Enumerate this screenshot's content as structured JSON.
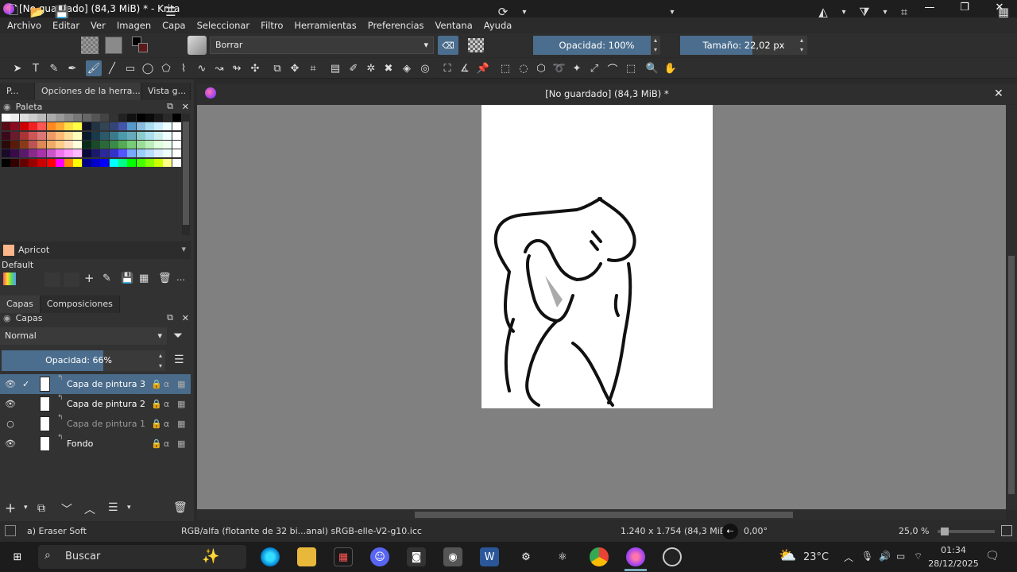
{
  "window": {
    "title": "[No guardado]  (84,3 MiB) * - Krita"
  },
  "menu": [
    "Archivo",
    "Editar",
    "Ver",
    "Imagen",
    "Capa",
    "Seleccionar",
    "Filtro",
    "Herramientas",
    "Preferencias",
    "Ventana",
    "Ayuda"
  ],
  "toolbar": {
    "blend_mode": "Borrar",
    "opacity_label": "Opacidad: 100%",
    "size_label": "Tamaño: 22,02 px"
  },
  "left_tabs": [
    "P...",
    "Opciones de la herra...",
    "Vista g..."
  ],
  "palette": {
    "title": "Paleta",
    "selected_color_name": "Apricot",
    "palette_name": "Default"
  },
  "layers_tabs": [
    "Capas",
    "Composiciones"
  ],
  "layers": {
    "title": "Capas",
    "blend_mode": "Normal",
    "opacity_label": "Opacidad:  66%",
    "opacity": 0.66,
    "items": [
      {
        "name": "Capa de pintura 3",
        "visible": true,
        "selected": true
      },
      {
        "name": "Capa de pintura 2",
        "visible": true,
        "selected": false
      },
      {
        "name": "Capa de pintura 1",
        "visible": false,
        "selected": false
      },
      {
        "name": "Fondo",
        "visible": true,
        "selected": false
      }
    ]
  },
  "document": {
    "title": "[No guardado]  (84,3 MiB) *"
  },
  "status": {
    "brush": "a) Eraser Soft",
    "color_space": "RGB/alfa (flotante de 32 bi...anal)  sRGB-elle-V2-g10.icc",
    "dimensions": "1.240 x 1.754 (84,3 MiB)",
    "rotation": "0,00°",
    "zoom": "25,0 %"
  },
  "taskbar": {
    "search_placeholder": "Buscar",
    "weather": "23°C",
    "time": "01:34",
    "date": "28/12/2025"
  },
  "colors": {
    "accent": "#4b6e8e",
    "selected_layer": "#4a6b8a",
    "apricot": "#fbb68a"
  }
}
